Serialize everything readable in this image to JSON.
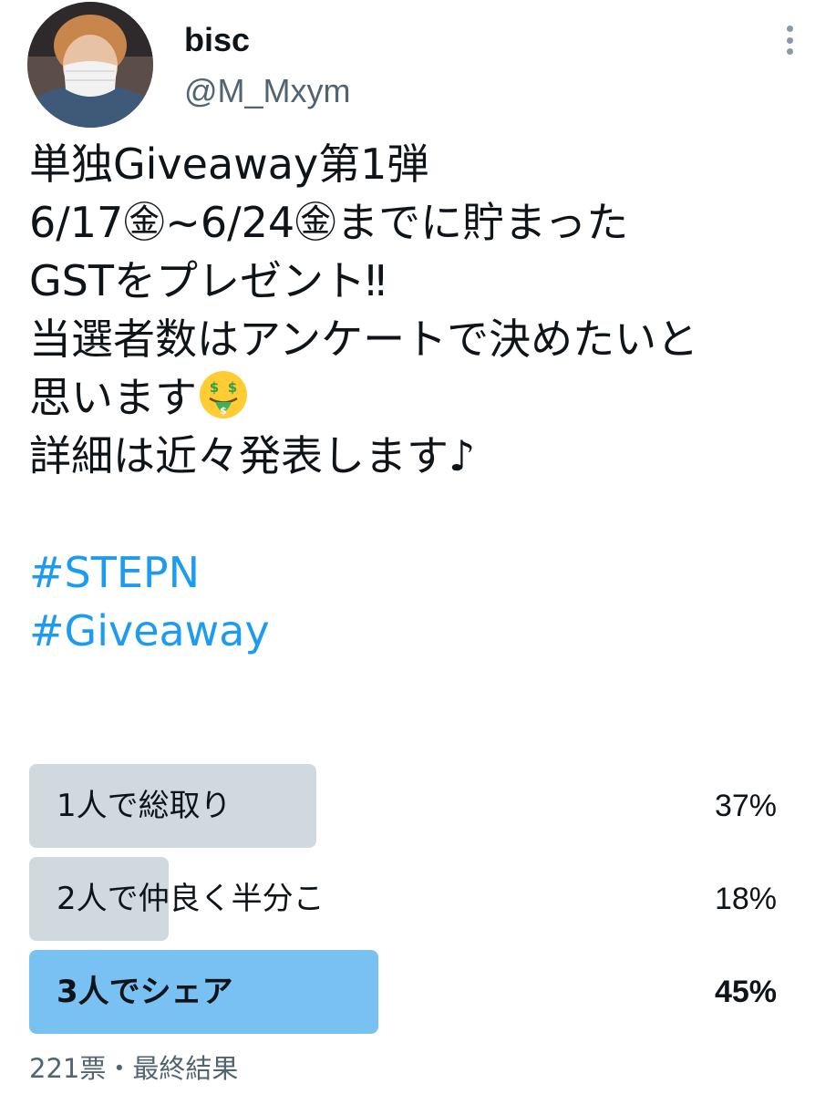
{
  "author": {
    "display_name": "bisc",
    "handle": "@M_Mxym",
    "avatar_icon": "user-avatar-photo",
    "more_icon": "more-options-icon"
  },
  "tweet": {
    "lines": [
      "単独Giveaway第1弾",
      "6/17㊎~6/24㊎までに貯まった",
      "GSTをプレゼント‼",
      "当選者数はアンケートで決めたいと",
      "思います",
      "詳細は近々発表します♪"
    ],
    "emoji": "money-mouth-face-icon",
    "hashtags": [
      "#STEPN",
      "#Giveaway"
    ]
  },
  "poll": {
    "options": [
      {
        "label": "1人で総取り",
        "percent": "37%",
        "fraction": 0.37,
        "winner": false
      },
      {
        "label": "2人で仲良く半分こ",
        "percent": "18%",
        "fraction": 0.18,
        "winner": false
      },
      {
        "label": "3人でシェア",
        "percent": "45%",
        "fraction": 0.45,
        "winner": true
      }
    ],
    "footer": "221票・最終結果"
  },
  "colors": {
    "link": "#1d9bf0",
    "bar": "#cfd9de",
    "winner_bar": "#79c1f2",
    "secondary_text": "#536471"
  }
}
